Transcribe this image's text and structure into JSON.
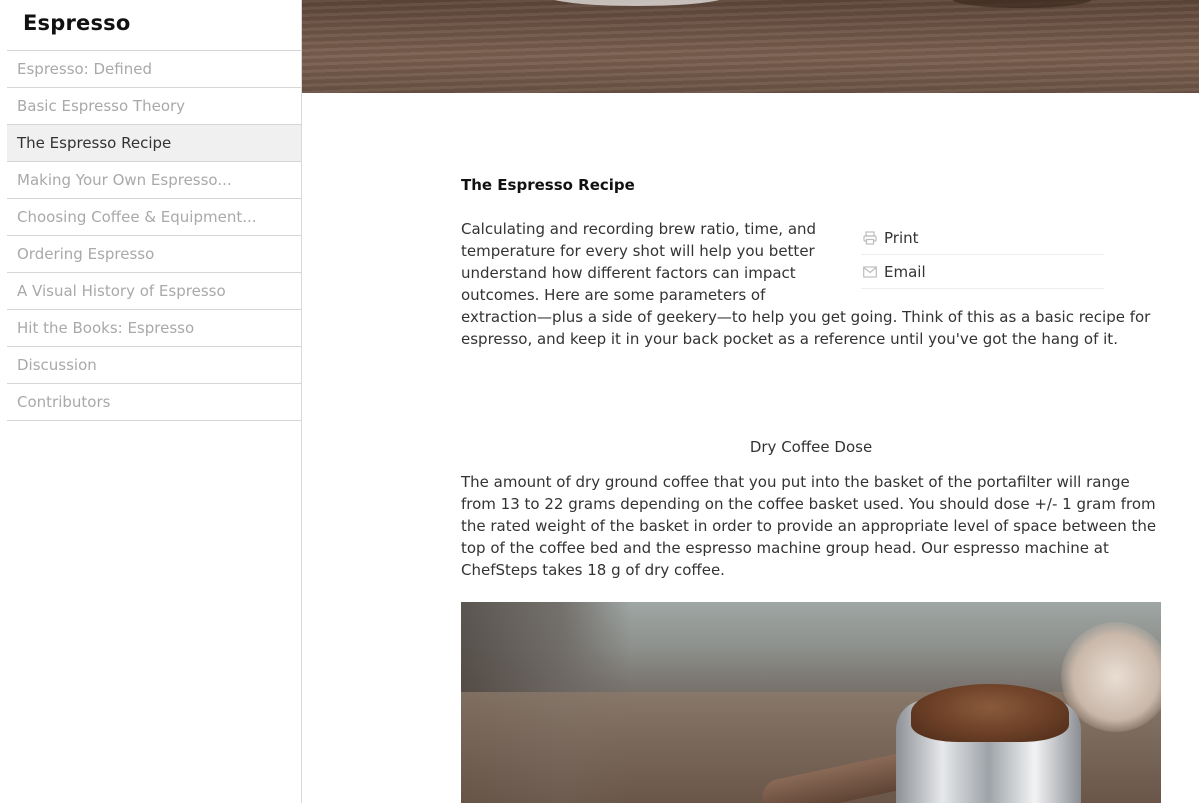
{
  "sidebar": {
    "title": "Espresso",
    "items": [
      {
        "label": "Espresso: Defined",
        "active": false
      },
      {
        "label": "Basic Espresso Theory",
        "active": false
      },
      {
        "label": "The Espresso Recipe",
        "active": true
      },
      {
        "label": "Making Your Own Espresso...",
        "active": false
      },
      {
        "label": "Choosing Coffee & Equipment...",
        "active": false
      },
      {
        "label": "Ordering Espresso",
        "active": false
      },
      {
        "label": "A Visual History of Espresso",
        "active": false
      },
      {
        "label": "Hit the Books: Espresso",
        "active": false
      },
      {
        "label": "Discussion",
        "active": false
      },
      {
        "label": "Contributors",
        "active": false
      }
    ]
  },
  "article": {
    "title": "The Espresso Recipe",
    "intro": "Calculating and recording brew ratio, time, and temperature for every shot will help you better understand how different factors can impact outcomes. Here are some parameters of extraction—plus a side of geekery—to help you get going. Think of this as a basic recipe for espresso, and keep it in your back pocket as a reference until you've got the hang of it.",
    "share": {
      "print_label": "Print",
      "print_icon": "printer-icon",
      "email_label": "Email",
      "email_icon": "envelope-icon"
    },
    "section_heading": "Dry Coffee Dose",
    "section_text": "The amount of dry ground coffee that you put into the basket of the portafilter will range from 13 to 22 grams depending on the coffee basket used. You should dose +/- 1 gram from the rated weight of the basket in order to provide an appropriate level of space between the top of the coffee bed and the espresso machine group head. Our espresso machine at ChefSteps takes 18 g of dry coffee."
  },
  "colors": {
    "active_item_bg": "#f0f0f0",
    "inactive_text": "#a9a9a9",
    "body_text": "#333333"
  }
}
